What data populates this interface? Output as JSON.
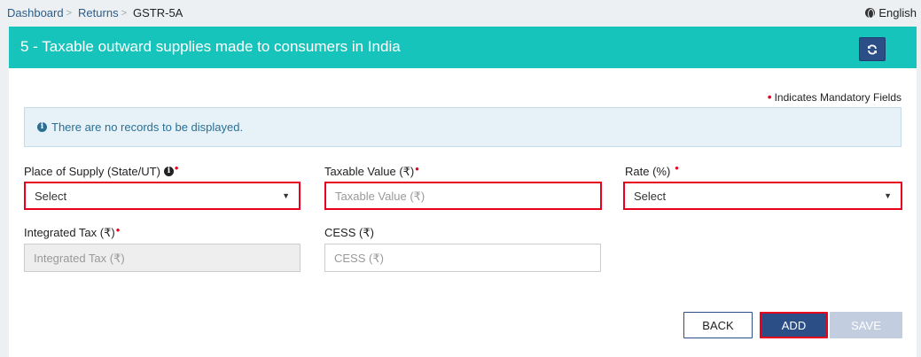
{
  "breadcrumb": {
    "items": [
      "Dashboard",
      "Returns"
    ],
    "current": "GSTR-5A"
  },
  "language": "English",
  "header": {
    "title": "5 - Taxable outward supplies made to consumers in India",
    "refresh_icon": "refresh-icon"
  },
  "mandatory_note": "Indicates Mandatory Fields",
  "alert": {
    "message": "There are no records to be displayed."
  },
  "form": {
    "place_of_supply": {
      "label": "Place of Supply (State/UT)",
      "value": "Select"
    },
    "taxable_value": {
      "label": "Taxable Value (₹)",
      "placeholder": "Taxable Value (₹)"
    },
    "rate": {
      "label": "Rate (%)",
      "value": "Select"
    },
    "integrated_tax": {
      "label": "Integrated Tax (₹)",
      "placeholder": "Integrated Tax (₹)"
    },
    "cess": {
      "label": "CESS (₹)",
      "placeholder": "CESS (₹)"
    }
  },
  "buttons": {
    "back": "BACK",
    "add": "ADD",
    "save": "SAVE"
  },
  "colors": {
    "header_bg": "#17c4bb",
    "primary": "#2c4e86",
    "error": "#e8001c",
    "alert_bg": "#e6f2f8"
  }
}
